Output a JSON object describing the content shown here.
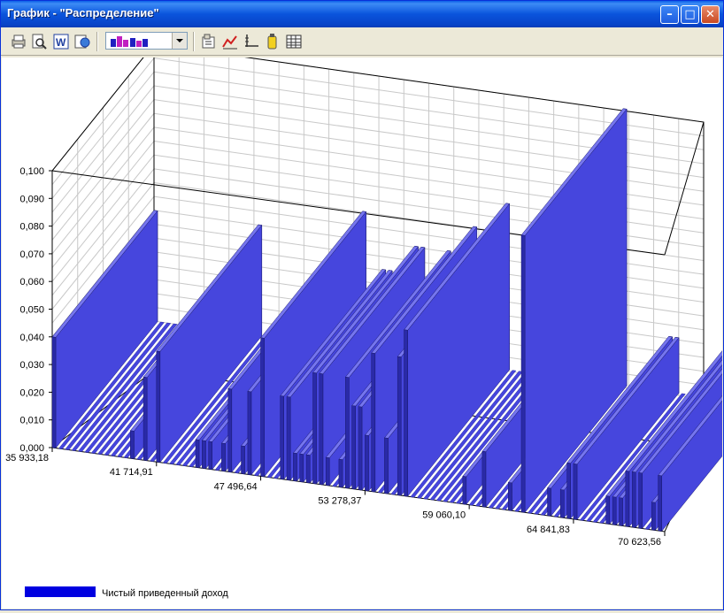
{
  "window": {
    "title": "График - \"Распределение\""
  },
  "toolbar": {
    "icons": [
      "print-icon",
      "print-preview-icon",
      "word-export-icon",
      "web-export-icon",
      "chart-type-icon",
      "properties-icon",
      "series-icon",
      "axes-icon",
      "palette-icon",
      "data-table-icon"
    ]
  },
  "colors": {
    "bar_front": "#4646DD",
    "bar_side": "#2A2AA8",
    "bar_top": "#7575EE",
    "legend": "#0000E0"
  },
  "chart_data": {
    "type": "bar",
    "title": "",
    "xlabel": "",
    "ylabel": "",
    "ylim": [
      0,
      0.1
    ],
    "yticks": [
      "0,000",
      "0,010",
      "0,020",
      "0,030",
      "0,040",
      "0,050",
      "0,060",
      "0,070",
      "0,080",
      "0,090",
      "0,100"
    ],
    "xticks": [
      "35 933,18",
      "41 714,91",
      "47 496,64",
      "53 278,37",
      "59 060,10",
      "64 841,83",
      "70 623,56"
    ],
    "grid": true,
    "legend_position": "bottom-left",
    "series": [
      {
        "name": "Чистый приведенный доход",
        "values": [
          0.04,
          0,
          0,
          0,
          0,
          0,
          0,
          0,
          0,
          0,
          0,
          0,
          0.01,
          0,
          0.03,
          0,
          0.04,
          0,
          0,
          0,
          0,
          0,
          0.01,
          0.01,
          0.01,
          0,
          0.01,
          0.03,
          0,
          0.01,
          0.03,
          0,
          0.05,
          0,
          0,
          0.03,
          0.03,
          0.01,
          0.01,
          0.01,
          0.04,
          0.04,
          0.01,
          0,
          0.01,
          0.04,
          0.03,
          0.03,
          0.02,
          0.05,
          0,
          0.02,
          0,
          0.05,
          0.06,
          0,
          0,
          0,
          0,
          0,
          0,
          0,
          0,
          0.01,
          0,
          0,
          0.02,
          0,
          0,
          0,
          0.01,
          0,
          0.1,
          0,
          0,
          0,
          0.01,
          0,
          0.01,
          0.02,
          0.02,
          0,
          0,
          0,
          0,
          0.01,
          0.01,
          0.01,
          0.02,
          0.02,
          0.02,
          0,
          0.01,
          0.02
        ]
      }
    ]
  }
}
